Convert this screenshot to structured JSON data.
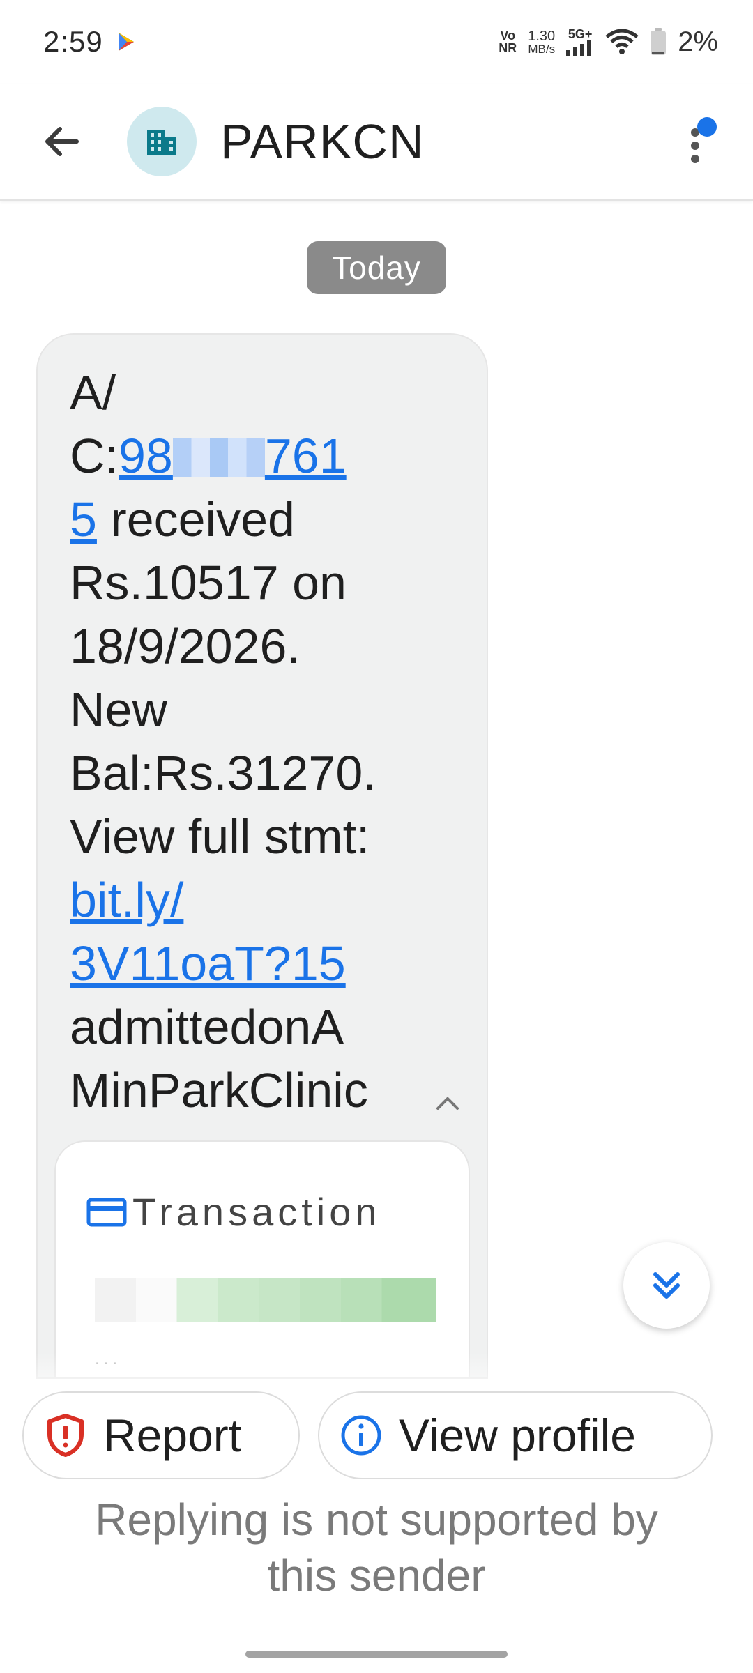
{
  "status_bar": {
    "time": "2:59",
    "volte_top": "Vo",
    "volte_bottom": "NR",
    "speed_value": "1.30",
    "speed_unit": "MB/s",
    "network": "5G+",
    "battery": "2%"
  },
  "header": {
    "title": "PARKCN"
  },
  "conversation": {
    "date_label": "Today",
    "message_lines": {
      "l1": "A/",
      "l2_prefix": "C:",
      "l2_link_a": "98",
      "l2_link_b": "761",
      "l3_link": "5",
      "l3_rest": " received",
      "l4": "Rs.10517 on",
      "l5": "18/9/2026.",
      "l6": "New",
      "l7": "Bal:Rs.31270.",
      "l8": "View full stmt:",
      "l9_link": "bit.ly/",
      "l10_link": "3V11oaT?15",
      "l11": "admittedonA",
      "l12": "MinParkClinic"
    },
    "card": {
      "title": "Transaction",
      "dots": "..."
    }
  },
  "actions": {
    "report_label": "Report",
    "view_profile_label": "View profile"
  },
  "footer": {
    "reply_note_line1": "Replying is not supported by",
    "reply_note_line2": "this sender"
  },
  "colors": {
    "accent": "#1a73e8",
    "report_red": "#d93025",
    "avatar_bg": "#cfe9ee",
    "avatar_icon": "#0b7a8a",
    "bubble_bg": "#f0f1f1",
    "date_chip": "#8a8a8a"
  },
  "icons": {
    "back": "arrow-left-icon",
    "avatar": "building-icon",
    "more": "more-vert-icon",
    "card": "credit-card-icon",
    "scroll": "double-chevron-down-icon",
    "report": "shield-alert-icon",
    "profile": "info-icon"
  }
}
